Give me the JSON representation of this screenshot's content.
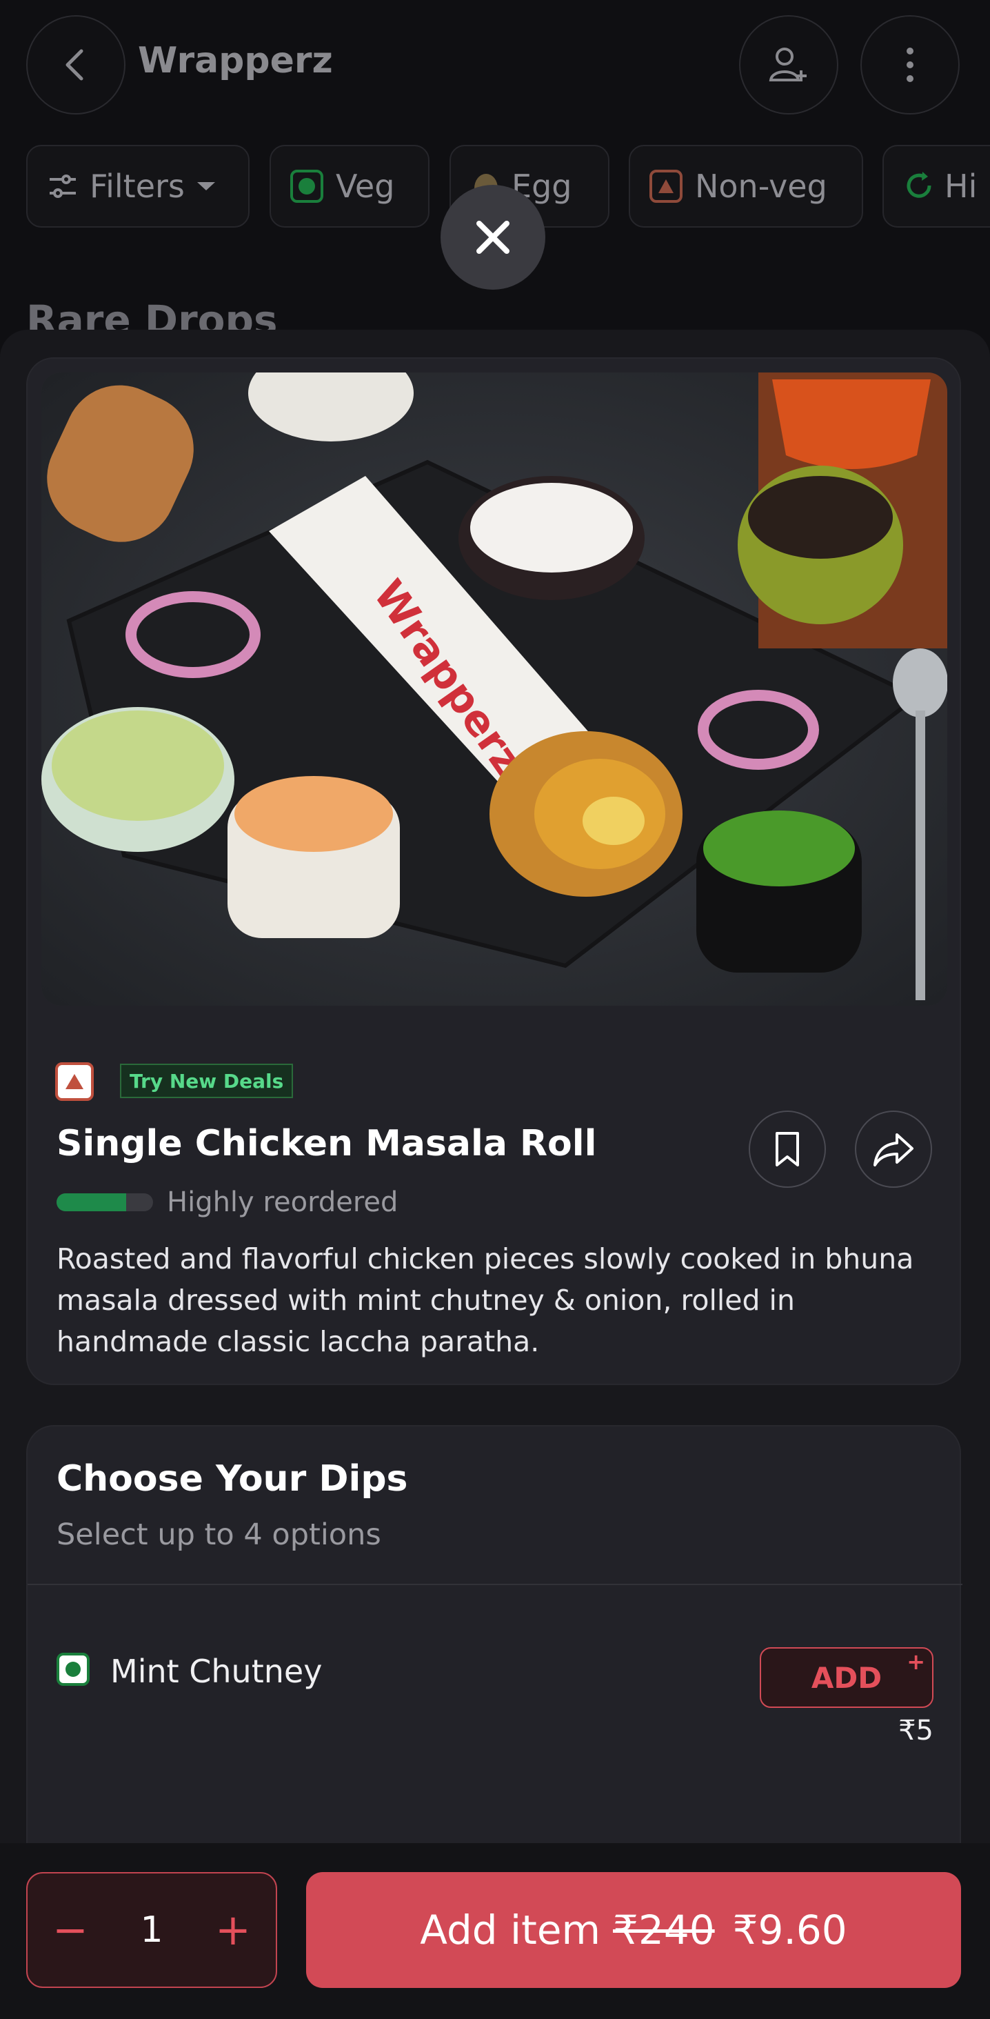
{
  "header": {
    "title": "Wrapperz",
    "back_icon": "chevron-left-icon",
    "group_icon": "add-person-icon",
    "menu_icon": "more-vertical-icon"
  },
  "filters": [
    {
      "label": "Filters",
      "icon": "sliders-icon"
    },
    {
      "label": "Veg",
      "icon": "veg-mark-icon"
    },
    {
      "label": "Egg",
      "icon": "egg-icon"
    },
    {
      "label": "Non-veg",
      "icon": "nonveg-mark-icon"
    },
    {
      "label": "Hi",
      "icon": "refresh-icon"
    }
  ],
  "background_section": {
    "title": "Rare Drops"
  },
  "item": {
    "badge": "Try New Deals",
    "name": "Single Chicken Masala Roll",
    "reorder_label": "Highly reordered",
    "reorder_level": 0.72,
    "description": "Roasted and flavorful chicken pieces slowly cooked in bhuna masala dressed with mint chutney & onion, rolled in handmade classic laccha paratha."
  },
  "dips": {
    "title": "Choose Your Dips",
    "subtitle": "Select up to 4 options",
    "options": [
      {
        "name": "Mint Chutney",
        "add_label": "ADD",
        "add_plus": "+",
        "price": "₹5"
      }
    ]
  },
  "bottom": {
    "qty_minus": "−",
    "quantity": "1",
    "qty_plus": "+",
    "add_label": "Add item",
    "old_price": "₹240",
    "new_price": "₹9.60"
  },
  "colors": {
    "accent": "#d24a56",
    "veg": "#1a7f3c",
    "nonveg": "#c0503e",
    "badge_text": "#57d98a"
  }
}
